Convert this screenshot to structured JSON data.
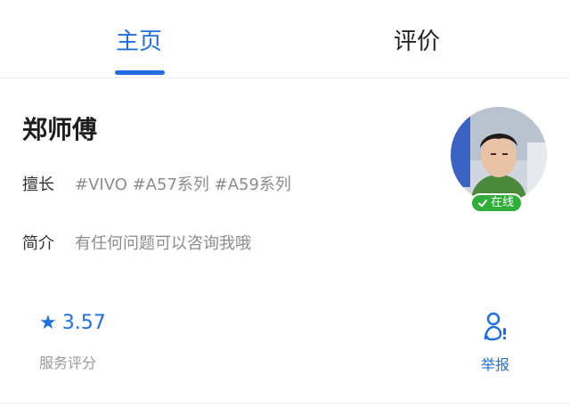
{
  "tabs": [
    {
      "label": "主页",
      "active": true
    },
    {
      "label": "评价",
      "active": false
    }
  ],
  "profile": {
    "name": "郑师傅",
    "specialty_label": "擅长",
    "specialty_value": "#VIVO #A57系列 #A59系列",
    "intro_label": "简介",
    "intro_value": "有任何问题可以咨询我哦",
    "status_badge": "在线"
  },
  "rating": {
    "value": "3.57",
    "label": "服务评分"
  },
  "report": {
    "label": "举报"
  },
  "colors": {
    "accent": "#1f6fe0",
    "online": "#2fae3a"
  }
}
